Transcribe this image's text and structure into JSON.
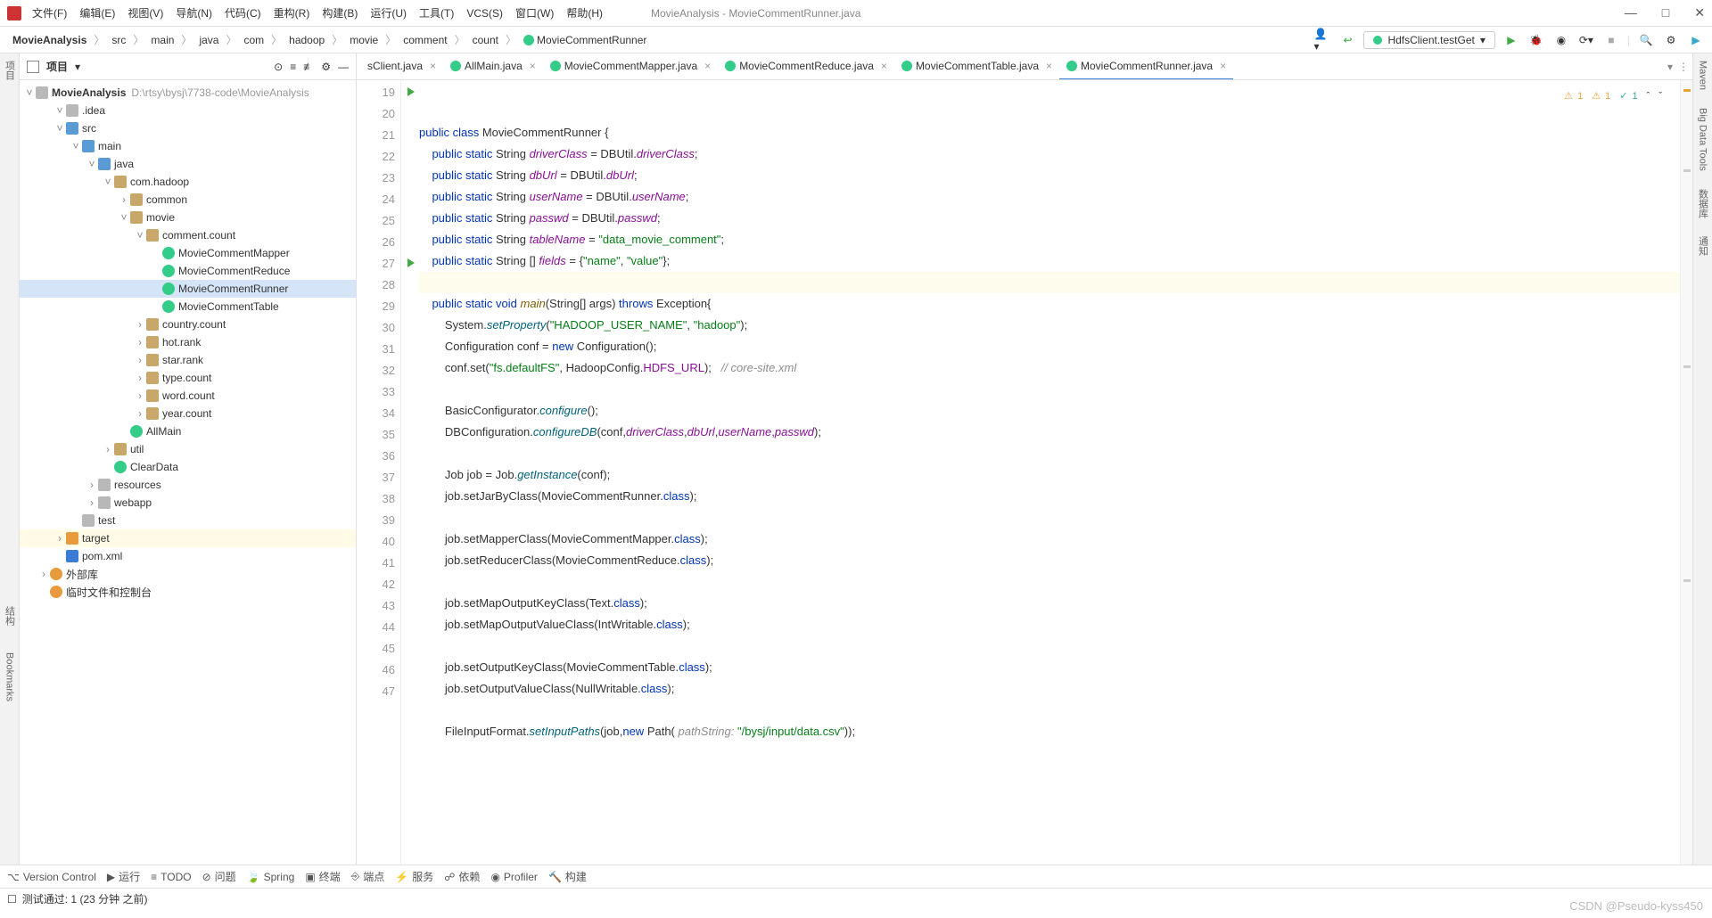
{
  "menu": {
    "items": [
      "文件(F)",
      "编辑(E)",
      "视图(V)",
      "导航(N)",
      "代码(C)",
      "重构(R)",
      "构建(B)",
      "运行(U)",
      "工具(T)",
      "VCS(S)",
      "窗口(W)",
      "帮助(H)"
    ],
    "title": "MovieAnalysis - MovieCommentRunner.java"
  },
  "breadcrumb": [
    "MovieAnalysis",
    "src",
    "main",
    "java",
    "com",
    "hadoop",
    "movie",
    "comment",
    "count",
    "MovieCommentRunner"
  ],
  "run_config": "HdfsClient.testGet",
  "sidebar": {
    "title": "项目",
    "root": {
      "name": "MovieAnalysis",
      "path": "D:\\rtsy\\bysj\\7738-code\\MovieAnalysis"
    },
    "tree": [
      {
        "d": 1,
        "tw": "v",
        "ico": "folder",
        "lbl": ".idea"
      },
      {
        "d": 1,
        "tw": "v",
        "ico": "folder-blue",
        "lbl": "src"
      },
      {
        "d": 2,
        "tw": "v",
        "ico": "folder-blue",
        "lbl": "main"
      },
      {
        "d": 3,
        "tw": "v",
        "ico": "folder-blue",
        "lbl": "java"
      },
      {
        "d": 4,
        "tw": "v",
        "ico": "pkg",
        "lbl": "com.hadoop"
      },
      {
        "d": 5,
        "tw": ">",
        "ico": "pkg",
        "lbl": "common"
      },
      {
        "d": 5,
        "tw": "v",
        "ico": "pkg",
        "lbl": "movie"
      },
      {
        "d": 6,
        "tw": "v",
        "ico": "pkg",
        "lbl": "comment.count"
      },
      {
        "d": 7,
        "tw": "",
        "ico": "cls",
        "lbl": "MovieCommentMapper"
      },
      {
        "d": 7,
        "tw": "",
        "ico": "cls",
        "lbl": "MovieCommentReduce"
      },
      {
        "d": 7,
        "tw": "",
        "ico": "cls",
        "lbl": "MovieCommentRunner",
        "sel": true
      },
      {
        "d": 7,
        "tw": "",
        "ico": "cls",
        "lbl": "MovieCommentTable"
      },
      {
        "d": 6,
        "tw": ">",
        "ico": "pkg",
        "lbl": "country.count"
      },
      {
        "d": 6,
        "tw": ">",
        "ico": "pkg",
        "lbl": "hot.rank"
      },
      {
        "d": 6,
        "tw": ">",
        "ico": "pkg",
        "lbl": "star.rank"
      },
      {
        "d": 6,
        "tw": ">",
        "ico": "pkg",
        "lbl": "type.count"
      },
      {
        "d": 6,
        "tw": ">",
        "ico": "pkg",
        "lbl": "word.count"
      },
      {
        "d": 6,
        "tw": ">",
        "ico": "pkg",
        "lbl": "year.count"
      },
      {
        "d": 5,
        "tw": "",
        "ico": "cls",
        "lbl": "AllMain"
      },
      {
        "d": 4,
        "tw": ">",
        "ico": "pkg",
        "lbl": "util"
      },
      {
        "d": 4,
        "tw": "",
        "ico": "cls",
        "lbl": "ClearData"
      },
      {
        "d": 3,
        "tw": ">",
        "ico": "folder",
        "lbl": "resources"
      },
      {
        "d": 3,
        "tw": ">",
        "ico": "folder",
        "lbl": "webapp"
      },
      {
        "d": 2,
        "tw": "",
        "ico": "folder",
        "lbl": "test"
      },
      {
        "d": 1,
        "tw": ">",
        "ico": "folder-orange",
        "lbl": "target",
        "hi": true
      },
      {
        "d": 1,
        "tw": "",
        "ico": "m",
        "lbl": "pom.xml"
      },
      {
        "d": 0,
        "tw": ">",
        "ico": "lib",
        "lbl": "外部库"
      },
      {
        "d": 0,
        "tw": "",
        "ico": "lib",
        "lbl": "临时文件和控制台"
      }
    ]
  },
  "tabs": [
    {
      "lbl": "sClient.java",
      "partial": true
    },
    {
      "lbl": "AllMain.java"
    },
    {
      "lbl": "MovieCommentMapper.java"
    },
    {
      "lbl": "MovieCommentReduce.java"
    },
    {
      "lbl": "MovieCommentTable.java"
    },
    {
      "lbl": "MovieCommentRunner.java",
      "active": true
    }
  ],
  "indicators": {
    "err": "1",
    "warn": "1",
    "ok": "1"
  },
  "code": {
    "start": 19,
    "lines": [
      {
        "n": 19,
        "run": true,
        "html": "<span class='k'>public</span> <span class='k'>class</span> MovieCommentRunner {"
      },
      {
        "n": 20,
        "html": "    <span class='k'>public</span> <span class='k'>static</span> String <span class='fi'>driverClass</span> = DBUtil.<span class='fi'>driverClass</span>;"
      },
      {
        "n": 21,
        "html": "    <span class='k'>public</span> <span class='k'>static</span> String <span class='fi'>dbUrl</span> = DBUtil.<span class='fi'>dbUrl</span>;"
      },
      {
        "n": 22,
        "html": "    <span class='k'>public</span> <span class='k'>static</span> String <span class='fi'>userName</span> = DBUtil.<span class='fi'>userName</span>;"
      },
      {
        "n": 23,
        "html": "    <span class='k'>public</span> <span class='k'>static</span> String <span class='fi'>passwd</span> = DBUtil.<span class='fi'>passwd</span>;"
      },
      {
        "n": 24,
        "html": "    <span class='k'>public</span> <span class='k'>static</span> String <span class='fi'>tableName</span> = <span class='s'>\"data_movie_comment\"</span>;"
      },
      {
        "n": 25,
        "html": "    <span class='k'>public</span> <span class='k'>static</span> String [] <span class='fi'>fields</span> = {<span class='s'>\"name\"</span>, <span class='s'>\"value\"</span>};"
      },
      {
        "n": 26,
        "hl": true,
        "html": "    "
      },
      {
        "n": 27,
        "run": true,
        "html": "    <span class='k'>public</span> <span class='k'>static</span> <span class='k'>void</span> <span class='fn2'>main</span>(String[] args) <span class='k'>throws</span> Exception{"
      },
      {
        "n": 28,
        "html": "        System.<span class='fn'>setProperty</span>(<span class='s'>\"HADOOP_USER_NAME\"</span>, <span class='s'>\"hadoop\"</span>);"
      },
      {
        "n": 29,
        "html": "        Configuration conf = <span class='k'>new</span> Configuration();"
      },
      {
        "n": 30,
        "html": "        conf.set(<span class='s'>\"fs.defaultFS\"</span>, HadoopConfig.<span class='id'>HDFS_URL</span>);   <span class='cm'>// core-site.xml</span>"
      },
      {
        "n": 31,
        "html": ""
      },
      {
        "n": 32,
        "html": "        BasicConfigurator.<span class='fn'>configure</span>();"
      },
      {
        "n": 33,
        "html": "        DBConfiguration.<span class='fn'>configureDB</span>(conf,<span class='fi'>driverClass</span>,<span class='fi'>dbUrl</span>,<span class='fi'>userName</span>,<span class='fi'>passwd</span>);"
      },
      {
        "n": 34,
        "html": ""
      },
      {
        "n": 35,
        "html": "        Job job = Job.<span class='fn'>getInstance</span>(conf);"
      },
      {
        "n": 36,
        "html": "        job.setJarByClass(MovieCommentRunner.<span class='k'>class</span>);"
      },
      {
        "n": 37,
        "html": ""
      },
      {
        "n": 38,
        "html": "        job.setMapperClass(MovieCommentMapper.<span class='k'>class</span>);"
      },
      {
        "n": 39,
        "html": "        job.setReducerClass(MovieCommentReduce.<span class='k'>class</span>);"
      },
      {
        "n": 40,
        "html": ""
      },
      {
        "n": 41,
        "html": "        job.setMapOutputKeyClass(Text.<span class='k'>class</span>);"
      },
      {
        "n": 42,
        "html": "        job.setMapOutputValueClass(IntWritable.<span class='k'>class</span>);"
      },
      {
        "n": 43,
        "html": ""
      },
      {
        "n": 44,
        "html": "        job.setOutputKeyClass(MovieCommentTable.<span class='k'>class</span>);"
      },
      {
        "n": 45,
        "html": "        job.setOutputValueClass(NullWritable.<span class='k'>class</span>);"
      },
      {
        "n": 46,
        "html": ""
      },
      {
        "n": 47,
        "html": "        FileInputFormat.<span class='fn'>setInputPaths</span>(job,<span class='k'>new</span> Path( <span class='cm'>pathString:</span> <span class='s'>\"/bysj/input/data.csv\"</span>));"
      }
    ]
  },
  "left_tools": [
    "项目",
    "结构",
    "Bookmarks"
  ],
  "right_tools": [
    "Maven",
    "Big Data Tools",
    "数据库",
    "通知"
  ],
  "bottom": [
    "Version Control",
    "运行",
    "TODO",
    "问题",
    "Spring",
    "终端",
    "端点",
    "服务",
    "依赖",
    "Profiler",
    "构建"
  ],
  "status": {
    "msg": "测试通过: 1 (23 分钟 之前)"
  },
  "watermark": "CSDN @Pseudo-kyss450"
}
